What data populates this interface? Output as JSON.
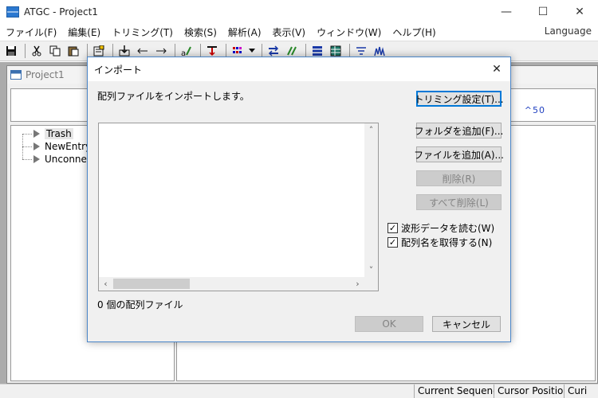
{
  "window": {
    "title": "ATGC - Project1",
    "minimize": "—",
    "maximize": "☐",
    "close": "✕"
  },
  "menu": {
    "items": [
      "ファイル(F)",
      "編集(E)",
      "トリミング(T)",
      "検索(S)",
      "解析(A)",
      "表示(V)",
      "ウィンドウ(W)",
      "ヘルプ(H)"
    ],
    "language": "Language"
  },
  "project": {
    "title": "Project1",
    "ruler": "^50",
    "tree": [
      "Trash",
      "NewEntry",
      "Unconnect"
    ]
  },
  "status": {
    "current_sequence": "Current Sequence",
    "cursor_position": "Cursor Position",
    "cut": "Curi"
  },
  "dialog": {
    "title": "インポート",
    "close": "✕",
    "description": "配列ファイルをインポートします。",
    "trim_settings": "トリミング設定(T)...",
    "add_folder": "フォルダを追加(F)...",
    "add_file": "ファイルを追加(A)...",
    "delete": "削除(R)",
    "delete_all": "すべて削除(L)",
    "read_waveform": "波形データを読む(W)",
    "get_seqname": "配列名を取得する(N)",
    "read_waveform_checked": true,
    "get_seqname_checked": true,
    "file_count": "0 個の配列ファイル",
    "ok": "OK",
    "cancel": "キャンセル"
  }
}
